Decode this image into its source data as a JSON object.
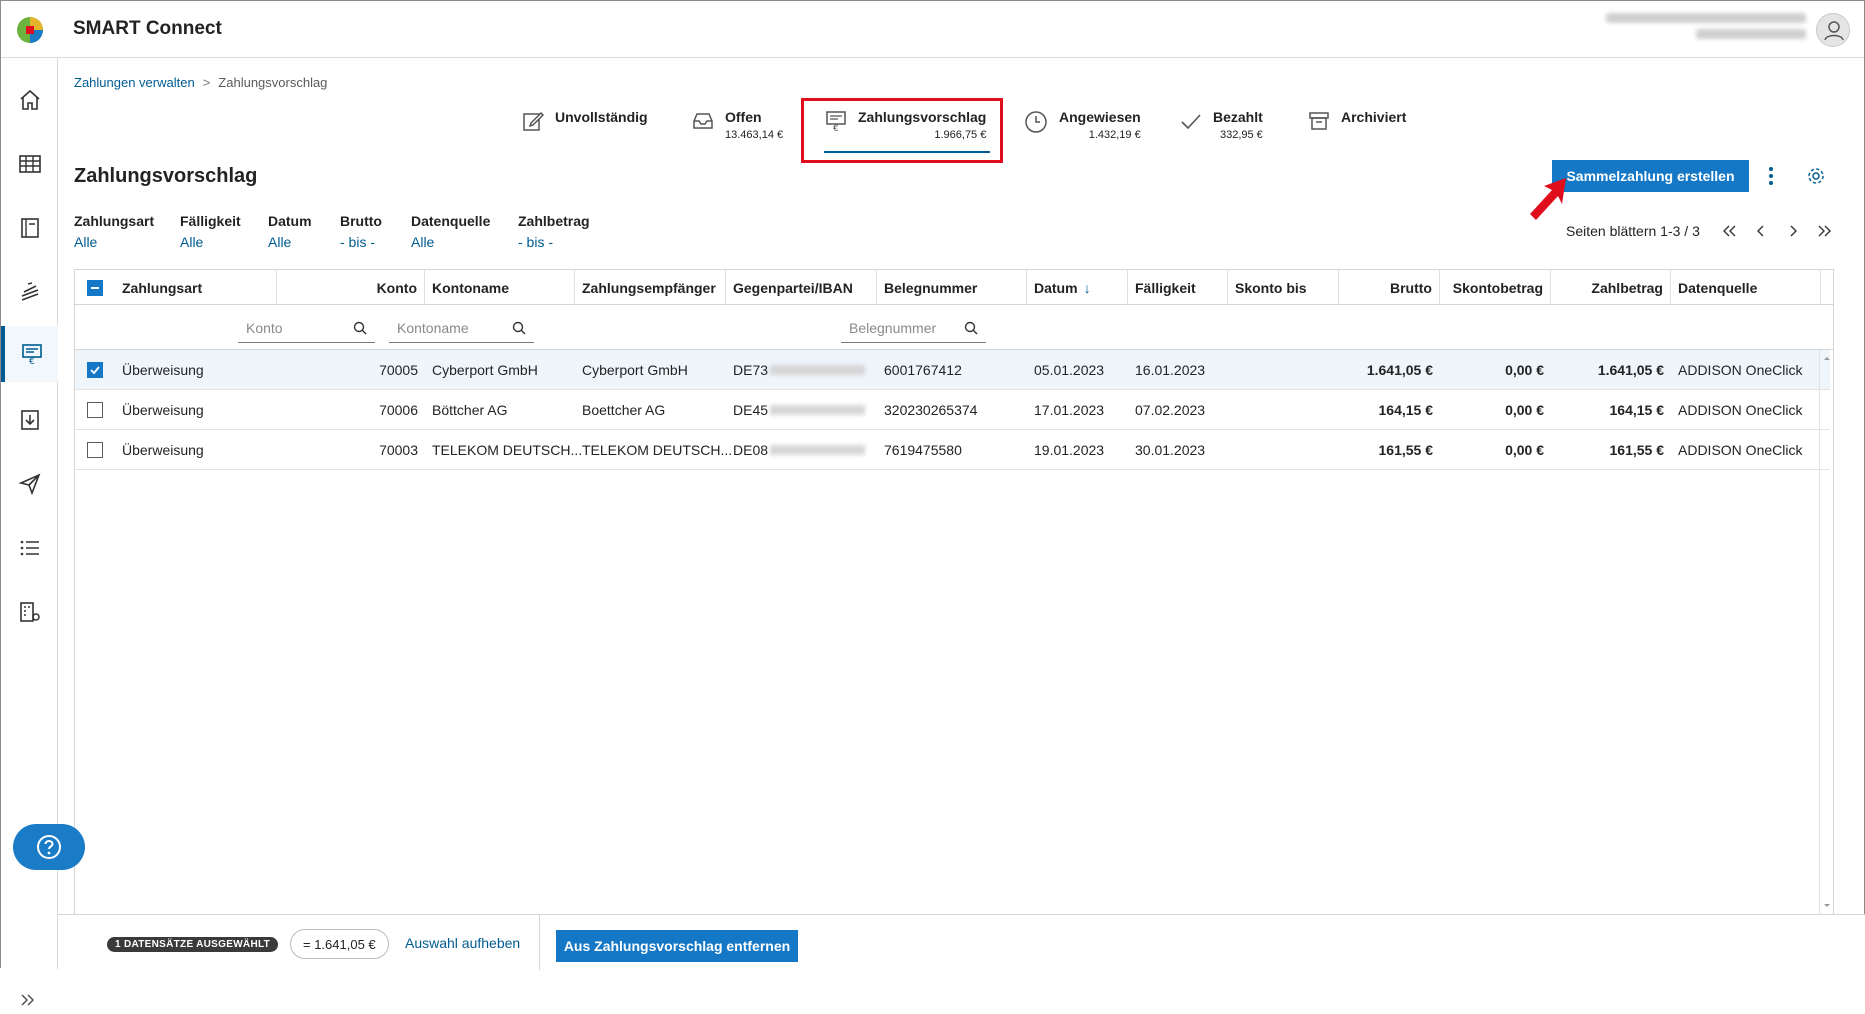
{
  "app": {
    "title": "SMART Connect"
  },
  "breadcrumb": {
    "parent": "Zahlungen verwalten",
    "separator": ">",
    "current": "Zahlungsvorschlag"
  },
  "status_tabs": [
    {
      "label": "Unvollständig",
      "amount": "",
      "icon": "edit-icon"
    },
    {
      "label": "Offen",
      "amount": "13.463,14 €",
      "icon": "inbox-icon"
    },
    {
      "label": "Zahlungsvorschlag",
      "amount": "1.966,75 €",
      "icon": "payment-proposal-icon",
      "active": true
    },
    {
      "label": "Angewiesen",
      "amount": "1.432,19 €",
      "icon": "clock-icon"
    },
    {
      "label": "Bezahlt",
      "amount": "332,95 €",
      "icon": "check-icon"
    },
    {
      "label": "Archiviert",
      "amount": "",
      "icon": "archive-icon"
    }
  ],
  "page": {
    "title": "Zahlungsvorschlag",
    "primary_action": "Sammelzahlung erstellen"
  },
  "filters": [
    {
      "label": "Zahlungsart",
      "value": "Alle"
    },
    {
      "label": "Fälligkeit",
      "value": "Alle"
    },
    {
      "label": "Datum",
      "value": "Alle"
    },
    {
      "label": "Brutto",
      "value": "- bis -"
    },
    {
      "label": "Datenquelle",
      "value": "Alle"
    },
    {
      "label": "Zahlbetrag",
      "value": "- bis -"
    }
  ],
  "paging": {
    "text": "Seiten blättern 1-3 / 3"
  },
  "table": {
    "columns": [
      "Zahlungsart",
      "Konto",
      "Kontoname",
      "Zahlungsempfänger",
      "Gegenpartei/IBAN",
      "Belegnummer",
      "Datum",
      "Fälligkeit",
      "Skonto bis",
      "Brutto",
      "Skontobetrag",
      "Zahlbetrag",
      "Datenquelle"
    ],
    "sort_indicator": "↓",
    "filter_placeholders": {
      "konto": "Konto",
      "kontoname": "Kontoname",
      "belegnummer": "Belegnummer"
    },
    "rows": [
      {
        "selected": true,
        "zahlungsart": "Überweisung",
        "konto": "70005",
        "kontoname": "Cyberport GmbH",
        "empfaenger": "Cyberport GmbH",
        "iban": "DE73",
        "belegnummer": "6001767412",
        "datum": "05.01.2023",
        "faelligkeit": "16.01.2023",
        "skonto_bis": "",
        "brutto": "1.641,05 €",
        "skontobetrag": "0,00 €",
        "zahlbetrag": "1.641,05 €",
        "datenquelle": "ADDISON OneClick"
      },
      {
        "selected": false,
        "zahlungsart": "Überweisung",
        "konto": "70006",
        "kontoname": "Böttcher AG",
        "empfaenger": "Boettcher AG",
        "iban": "DE45",
        "belegnummer": "320230265374",
        "datum": "17.01.2023",
        "faelligkeit": "07.02.2023",
        "skonto_bis": "",
        "brutto": "164,15 €",
        "skontobetrag": "0,00 €",
        "zahlbetrag": "164,15 €",
        "datenquelle": "ADDISON OneClick"
      },
      {
        "selected": false,
        "zahlungsart": "Überweisung",
        "konto": "70003",
        "kontoname": "TELEKOM DEUTSCH...",
        "empfaenger": "TELEKOM DEUTSCH...",
        "iban": "DE08",
        "belegnummer": "7619475580",
        "datum": "19.01.2023",
        "faelligkeit": "30.01.2023",
        "skonto_bis": "",
        "brutto": "161,55 €",
        "skontobetrag": "0,00 €",
        "zahlbetrag": "161,55 €",
        "datenquelle": "ADDISON OneClick"
      }
    ]
  },
  "footer": {
    "selected_badge": "1 DATENSÄTZE AUSGEWÄHLT",
    "sum": "= 1.641,05 €",
    "clear_selection": "Auswahl aufheben",
    "remove_action": "Aus Zahlungsvorschlag entfernen"
  },
  "colors": {
    "accent": "#1478c6",
    "link": "#005b92",
    "highlight": "#e00d1c"
  }
}
